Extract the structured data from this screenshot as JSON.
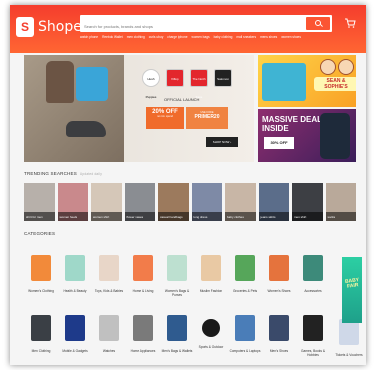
{
  "header": {
    "logo": "Shopee",
    "search_placeholder": "Search for products, brands and shops",
    "suggestions": [
      "watch phone",
      "Reebok Wallet",
      "men clothing",
      "curls ubuy",
      "charge iphone",
      "women bags",
      "baby clothing",
      "mall sneakers",
      "mens shoes",
      "women shoes"
    ]
  },
  "banner": {
    "brands": [
      "Hush Puppies",
      "fitflop",
      "The North Face",
      "Salomon"
    ],
    "launch_text": "OFFICIAL LAUNCH",
    "discount": "20% OFF",
    "discount_note": "no min. spend",
    "code_label": "USE CODE",
    "code": "PRIMER20",
    "shop_now": "SHOP NOW ›",
    "right_top_title": "SEAN & SOPHIE'S",
    "right_bottom_title": "MASSIVE DEALS INSIDE",
    "right_bottom_offer": "30% OFF"
  },
  "trending": {
    "title": "TRENDING SEARCHES",
    "subtitle": "Updated daily",
    "items": [
      "shirt for men",
      "women heels",
      "women shirt",
      "flower vases",
      "casual handbags",
      "long dress",
      "baby clothes",
      "jeans skirts",
      "men shirt",
      "socks"
    ]
  },
  "categories": {
    "title": "CATEGORIES",
    "row1": [
      {
        "label": "Women's Clothing",
        "color": "#f28a3a"
      },
      {
        "label": "Health & Beauty",
        "color": "#9fd8c9"
      },
      {
        "label": "Toys, Kids & Babies",
        "color": "#e8d6c8"
      },
      {
        "label": "Home & Living",
        "color": "#f27c4a"
      },
      {
        "label": "Women's Bags & Purses",
        "color": "#bde0d0"
      },
      {
        "label": "Muslim Fashion",
        "color": "#e9c9a4"
      },
      {
        "label": "Groceries & Pets",
        "color": "#56a65a"
      },
      {
        "label": "Women's Shoes",
        "color": "#e5733d"
      },
      {
        "label": "Accessories",
        "color": "#3d8a7a"
      }
    ],
    "row2": [
      {
        "label": "Men Clothing",
        "color": "#3a3f45"
      },
      {
        "label": "Mobile & Gadgets",
        "color": "#1e3a8a"
      },
      {
        "label": "Watches",
        "color": "#c0c0c0"
      },
      {
        "label": "Home Appliances",
        "color": "#7a7a7a"
      },
      {
        "label": "Men's Bags & Wallets",
        "color": "#2f5b8f"
      },
      {
        "label": "Sports & Outdoor",
        "color": "#1a1a1a"
      },
      {
        "label": "Computers & Laptops",
        "color": "#4a7db8"
      },
      {
        "label": "Men's Shoes",
        "color": "#3a4a6a"
      },
      {
        "label": "Games, Books & Hobbies",
        "color": "#222222"
      }
    ],
    "extra_row1": "E",
    "extra_row2": "Tickets & Vouchers"
  },
  "side_promo": {
    "text": "BABY FAIR"
  }
}
